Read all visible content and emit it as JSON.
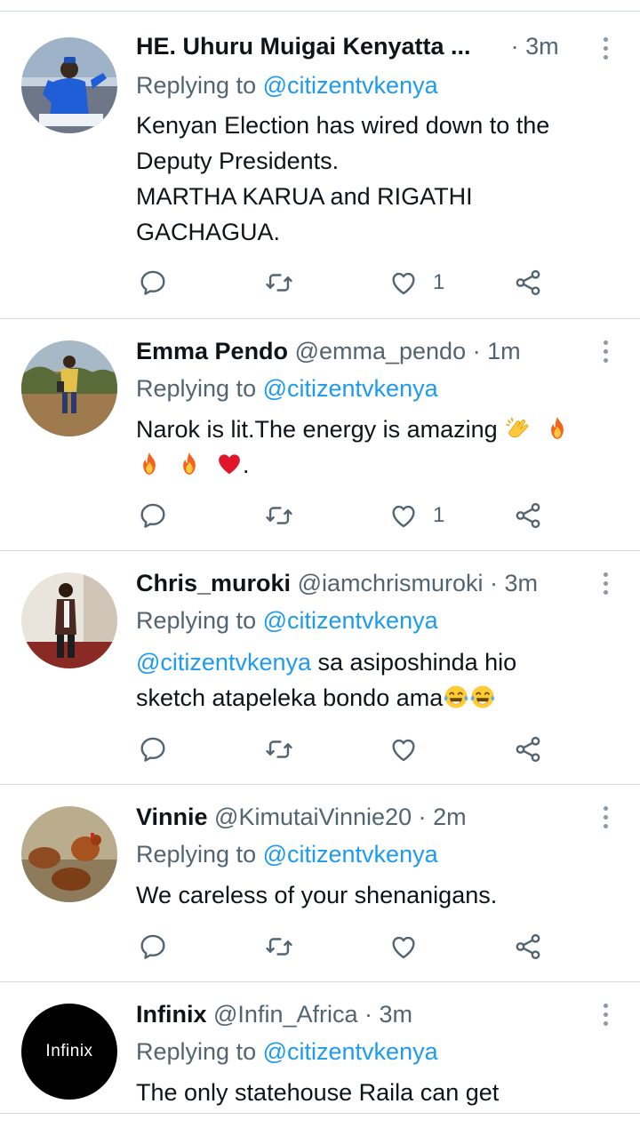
{
  "tweets": [
    {
      "name": "HE. Uhuru Muigai Kenyatta ...",
      "handle": "",
      "time": "· 3m",
      "reply_prefix": "Replying to",
      "reply_to": "@citizentvkenya",
      "lines": [
        "Kenyan Election has wired down to the",
        "Deputy Presidents.",
        "MARTHA KARUA and RIGATHI",
        "GACHAGUA."
      ],
      "likes": "1"
    },
    {
      "name": "Emma Pendo",
      "handle": "@emma_pendo",
      "time": "· 1m",
      "reply_prefix": "Replying to",
      "reply_to": "@citizentvkenya",
      "lines": [
        "Narok is lit.The energy is amazing"
      ],
      "tail": ".",
      "likes": "1"
    },
    {
      "name": "Chris_muroki",
      "handle": "@iamchrismuroki",
      "time": "· 3m",
      "reply_prefix": "Replying to",
      "reply_to": "@citizentvkenya",
      "mention": "@citizentvkenya",
      "lines": [
        "sa asiposhinda hio",
        "sketch atapeleka bondo ama"
      ],
      "likes": ""
    },
    {
      "name": "Vinnie",
      "handle": "@KimutaiVinnie20",
      "time": "· 2m",
      "reply_prefix": "Replying to",
      "reply_to": "@citizentvkenya",
      "lines": [
        "We careless of your shenanigans."
      ],
      "likes": ""
    },
    {
      "name": "Infinix",
      "handle": "@Infin_Africa",
      "time": "· 3m",
      "reply_prefix": "Replying to",
      "reply_to": "@citizentvkenya",
      "lines": [
        "The only statehouse Raila can get"
      ],
      "likes": "",
      "avatar_text": "Infinix"
    }
  ],
  "icons": {
    "reply": "reply-icon",
    "retweet": "retweet-icon",
    "like": "heart-icon",
    "share": "share-icon",
    "more": "more-icon"
  },
  "colors": {
    "mention": "#1d9bf0",
    "secondary": "#536471",
    "fire": "#f5621a",
    "heart": "#e0162b"
  }
}
